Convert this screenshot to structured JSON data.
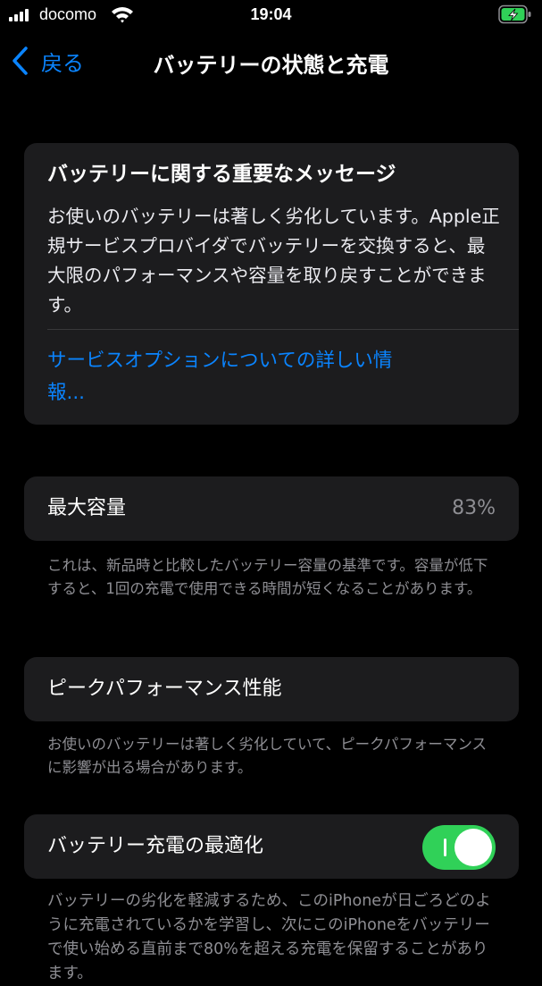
{
  "status_bar": {
    "carrier": "docomo",
    "time": "19:04"
  },
  "nav": {
    "back_label": "戻る",
    "title": "バッテリーの状態と充電"
  },
  "message_card": {
    "title": "バッテリーに関する重要なメッセージ",
    "body": "お使いのバッテリーは著しく劣化しています。Apple正規サービスプロバイダでバッテリーを交換すると、最大限のパフォーマンスや容量を取り戻すことができます。",
    "link": "サービスオプションについての詳しい情報..."
  },
  "max_capacity": {
    "label": "最大容量",
    "value": "83%",
    "footnote": "これは、新品時と比較したバッテリー容量の基準です。容量が低下すると、1回の充電で使用できる時間が短くなることがあります。"
  },
  "peak_performance": {
    "label": "ピークパフォーマンス性能",
    "footnote": "お使いのバッテリーは著しく劣化していて、ピークパフォーマンスに影響が出る場合があります。"
  },
  "optimized_charging": {
    "label": "バッテリー充電の最適化",
    "enabled": true,
    "footnote": "バッテリーの劣化を軽減するため、このiPhoneが日ごろどのように充電されているかを学習し、次にこのiPhoneをバッテリーで使い始める直前まで80%を超える充電を保留することがあります。"
  },
  "colors": {
    "accent": "#0a84ff",
    "toggle_on": "#30d158",
    "card_bg": "#1c1c1e",
    "secondary_text": "#8e8e93"
  },
  "icons": {
    "signal": "cellular-signal-icon",
    "wifi": "wifi-icon",
    "battery": "battery-charging-icon",
    "back": "chevron-left-icon"
  }
}
